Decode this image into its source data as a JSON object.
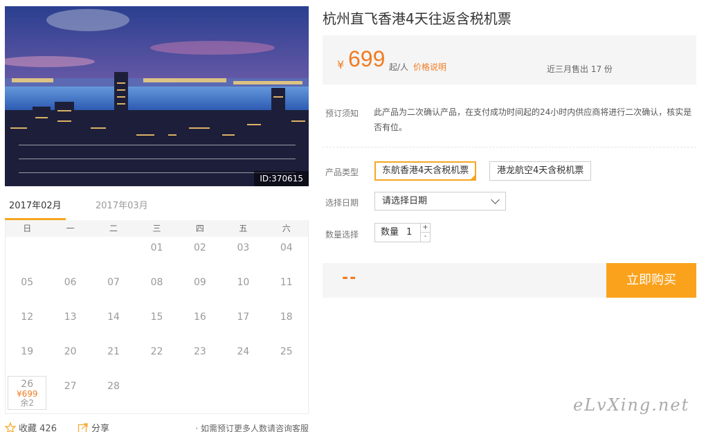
{
  "hero": {
    "image_id": "ID:370615"
  },
  "calendar": {
    "month_tabs": [
      "2017年02月",
      "2017年03月"
    ],
    "weekdays": [
      "日",
      "一",
      "二",
      "三",
      "四",
      "五",
      "六"
    ],
    "days": [
      {
        "day": "",
        "price": "",
        "left": ""
      },
      {
        "day": "",
        "price": "",
        "left": ""
      },
      {
        "day": "",
        "price": "",
        "left": ""
      },
      {
        "day": "01",
        "price": "",
        "left": ""
      },
      {
        "day": "02",
        "price": "",
        "left": ""
      },
      {
        "day": "03",
        "price": "",
        "left": ""
      },
      {
        "day": "04",
        "price": "",
        "left": ""
      },
      {
        "day": "05",
        "price": "",
        "left": ""
      },
      {
        "day": "06",
        "price": "",
        "left": ""
      },
      {
        "day": "07",
        "price": "",
        "left": ""
      },
      {
        "day": "08",
        "price": "",
        "left": ""
      },
      {
        "day": "09",
        "price": "",
        "left": ""
      },
      {
        "day": "10",
        "price": "",
        "left": ""
      },
      {
        "day": "11",
        "price": "",
        "left": ""
      },
      {
        "day": "12",
        "price": "",
        "left": ""
      },
      {
        "day": "13",
        "price": "",
        "left": ""
      },
      {
        "day": "14",
        "price": "",
        "left": ""
      },
      {
        "day": "15",
        "price": "",
        "left": ""
      },
      {
        "day": "16",
        "price": "",
        "left": ""
      },
      {
        "day": "17",
        "price": "",
        "left": ""
      },
      {
        "day": "18",
        "price": "",
        "left": ""
      },
      {
        "day": "19",
        "price": "",
        "left": ""
      },
      {
        "day": "20",
        "price": "",
        "left": ""
      },
      {
        "day": "21",
        "price": "",
        "left": ""
      },
      {
        "day": "22",
        "price": "",
        "left": ""
      },
      {
        "day": "23",
        "price": "",
        "left": ""
      },
      {
        "day": "24",
        "price": "",
        "left": ""
      },
      {
        "day": "25",
        "price": "",
        "left": ""
      },
      {
        "day": "26",
        "price": "¥699",
        "left": "余2"
      },
      {
        "day": "27",
        "price": "",
        "left": ""
      },
      {
        "day": "28",
        "price": "",
        "left": ""
      }
    ]
  },
  "actions": {
    "favorite_label": "收藏",
    "favorite_count": "426",
    "share_label": "分享",
    "consult_note": "· 如需预订更多人数请咨询客服"
  },
  "product": {
    "title": "杭州直飞香港4天往返含税机票",
    "currency": "¥",
    "price": "699",
    "per_person": "起/人",
    "price_note": "价格说明",
    "sold": "近三月售出 17 份"
  },
  "booking": {
    "notice_label": "预订须知",
    "notice_text": "此产品为二次确认产品，在支付成功时间起的24小时内供应商将进行二次确认，核实是否有位。",
    "type_label": "产品类型",
    "types": [
      "东航香港4天含税机票",
      "港龙航空4天含税机票"
    ],
    "date_label": "选择日期",
    "date_placeholder": "请选择日期",
    "qty_label": "数量选择",
    "qty_field_label": "数量",
    "qty_value": "1",
    "qty_plus": "+",
    "qty_minus": "-"
  },
  "buy": {
    "total": "--",
    "button": "立即购买"
  },
  "watermark": "eLvXing.net",
  "colors": {
    "accent": "#f07c22",
    "button": "#fba21c",
    "selected_border": "#f5a623"
  }
}
